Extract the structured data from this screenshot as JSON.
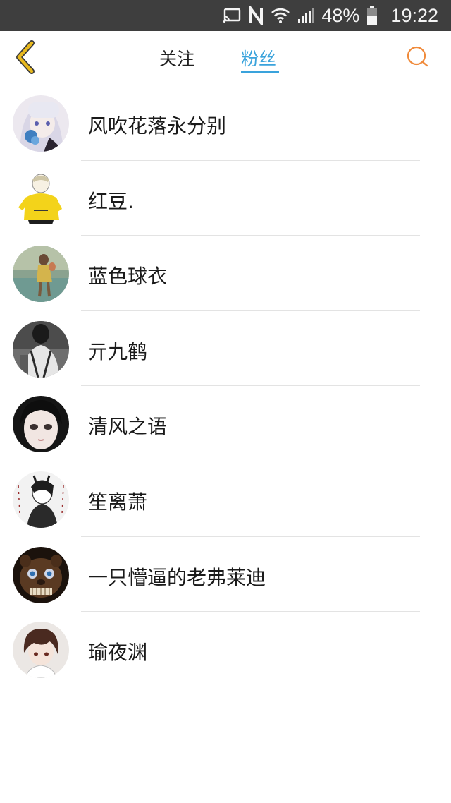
{
  "status_bar": {
    "battery": "48%",
    "time": "19:22",
    "icons": [
      "cast-icon",
      "nfc-icon",
      "wifi-icon",
      "signal-icon",
      "battery-icon"
    ]
  },
  "header": {
    "tabs": [
      {
        "label": "关注",
        "active": false
      },
      {
        "label": "粉丝",
        "active": true
      }
    ],
    "active_color": "#3aa3dc",
    "back_icon": "chevron-left-icon",
    "back_color": "#e0b21c",
    "search_icon": "search-icon",
    "search_color": "#f08a3a"
  },
  "fans": [
    {
      "name": "风吹花落永分别"
    },
    {
      "name": "红豆."
    },
    {
      "name": "蓝色球衣"
    },
    {
      "name": "亓九鹤"
    },
    {
      "name": "清风之语"
    },
    {
      "name": "笙离萧"
    },
    {
      "name": "一只懵逼的老弗莱迪"
    },
    {
      "name": "瑜夜渊"
    }
  ]
}
